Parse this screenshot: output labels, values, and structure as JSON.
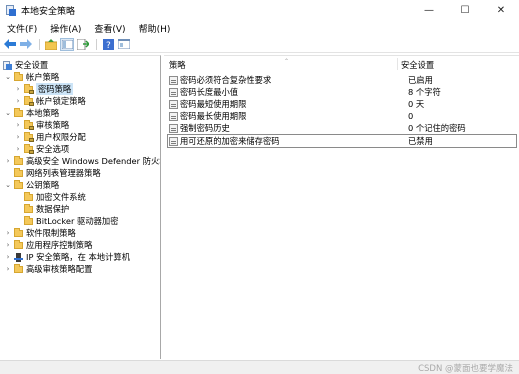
{
  "window": {
    "title": "本地安全策略",
    "controls": {
      "minimize": "—",
      "maximize": "☐",
      "close": "✕"
    }
  },
  "menu": [
    "文件(F)",
    "操作(A)",
    "查看(V)",
    "帮助(H)"
  ],
  "toolbar": {
    "icons": [
      "back-icon",
      "forward-icon",
      "up-folder-icon",
      "show-hide-tree-icon",
      "export-list-icon",
      "help-icon",
      "properties-icon"
    ]
  },
  "tree": [
    {
      "label": "安全设置",
      "icon": "computer-policy-icon",
      "expander": ""
    },
    {
      "label": "帐户策略",
      "icon": "folder-icon",
      "expander": "⌄"
    },
    {
      "label": "密码策略",
      "icon": "folder-lock-icon",
      "expander": "›",
      "selected": true
    },
    {
      "label": "帐户锁定策略",
      "icon": "folder-lock-icon",
      "expander": "›"
    },
    {
      "label": "本地策略",
      "icon": "folder-icon",
      "expander": "⌄"
    },
    {
      "label": "审核策略",
      "icon": "folder-lock-icon",
      "expander": "›"
    },
    {
      "label": "用户权限分配",
      "icon": "folder-lock-icon",
      "expander": "›"
    },
    {
      "label": "安全选项",
      "icon": "folder-lock-icon",
      "expander": "›"
    },
    {
      "label": "高级安全 Windows Defender 防火墙",
      "icon": "folder-icon",
      "expander": "›"
    },
    {
      "label": "网络列表管理器策略",
      "icon": "folder-icon",
      "expander": ""
    },
    {
      "label": "公钥策略",
      "icon": "folder-icon",
      "expander": "⌄"
    },
    {
      "label": "加密文件系统",
      "icon": "folder-icon",
      "expander": ""
    },
    {
      "label": "数据保护",
      "icon": "folder-icon",
      "expander": ""
    },
    {
      "label": "BitLocker 驱动器加密",
      "icon": "folder-icon",
      "expander": ""
    },
    {
      "label": "软件限制策略",
      "icon": "folder-icon",
      "expander": "›"
    },
    {
      "label": "应用程序控制策略",
      "icon": "folder-icon",
      "expander": "›"
    },
    {
      "label": "IP 安全策略，在 本地计算机",
      "icon": "ip-security-icon",
      "expander": "›"
    },
    {
      "label": "高级审核策略配置",
      "icon": "folder-icon",
      "expander": "›"
    }
  ],
  "list": {
    "columns": {
      "policy": "策略",
      "setting": "安全设置"
    },
    "rows": [
      {
        "policy": "密码必须符合复杂性要求",
        "setting": "已启用"
      },
      {
        "policy": "密码长度最小值",
        "setting": "8 个字符"
      },
      {
        "policy": "密码最短使用期限",
        "setting": "0 天"
      },
      {
        "policy": "密码最长使用期限",
        "setting": "0"
      },
      {
        "policy": "强制密码历史",
        "setting": "0 个记住的密码"
      },
      {
        "policy": "用可还原的加密来储存密码",
        "setting": "已禁用",
        "focused": true
      }
    ]
  },
  "watermark": "CSDN @蒙面也要学魔法"
}
